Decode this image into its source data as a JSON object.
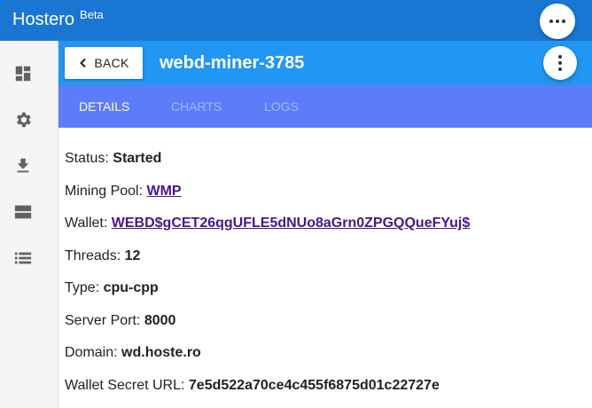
{
  "app": {
    "name": "Hostero",
    "badge": "Beta"
  },
  "sidebar": {
    "items": [
      {
        "icon": "dashboard-icon"
      },
      {
        "icon": "settings-icon"
      },
      {
        "icon": "download-icon"
      },
      {
        "icon": "storage-icon"
      },
      {
        "icon": "list-icon"
      }
    ]
  },
  "header": {
    "back_label": "BACK",
    "title": "webd-miner-3785"
  },
  "tabs": [
    {
      "label": "DETAILS",
      "active": true
    },
    {
      "label": "CHARTS",
      "active": false
    },
    {
      "label": "LOGS",
      "active": false
    }
  ],
  "details": {
    "status": {
      "label": "Status:",
      "value": "Started"
    },
    "pool": {
      "label": "Mining Pool:",
      "value": "WMP"
    },
    "wallet": {
      "label": "Wallet:",
      "value": "WEBD$gCET26qgUFLE5dNUo8aGrn0ZPGQQueFYuj$"
    },
    "threads": {
      "label": "Threads:",
      "value": "12"
    },
    "type": {
      "label": "Type:",
      "value": "cpu-cpp"
    },
    "port": {
      "label": "Server Port:",
      "value": "8000"
    },
    "domain": {
      "label": "Domain:",
      "value": "wd.hoste.ro"
    },
    "secret": {
      "label": "Wallet Secret URL:",
      "value": "7e5d522a70ce4c455f6875d01c22727e"
    }
  }
}
